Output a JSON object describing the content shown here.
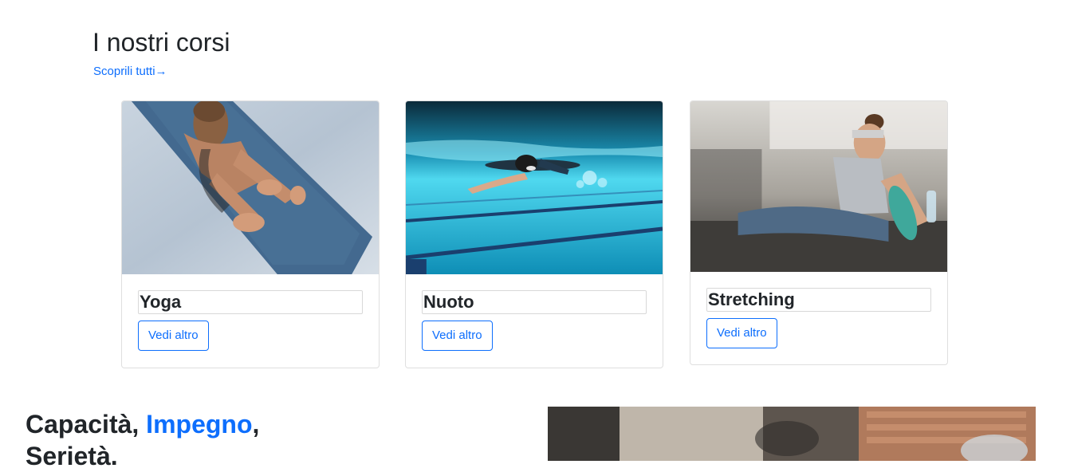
{
  "section": {
    "title": "I nostri corsi",
    "discover_link": "Scoprili tutti→"
  },
  "courses": [
    {
      "title": "Yoga",
      "button": "Vedi altro",
      "image": "yoga-photo"
    },
    {
      "title": "Nuoto",
      "button": "Vedi altro",
      "image": "swimming-photo"
    },
    {
      "title": "Stretching",
      "button": "Vedi altro",
      "image": "stretching-photo"
    }
  ],
  "headline": {
    "part1": "Capacità, ",
    "accent": "Impegno",
    "part2": ",",
    "part3": "Serietà."
  },
  "colors": {
    "accent": "#0d6efd",
    "text": "#212529",
    "border": "#dfdfdf"
  }
}
